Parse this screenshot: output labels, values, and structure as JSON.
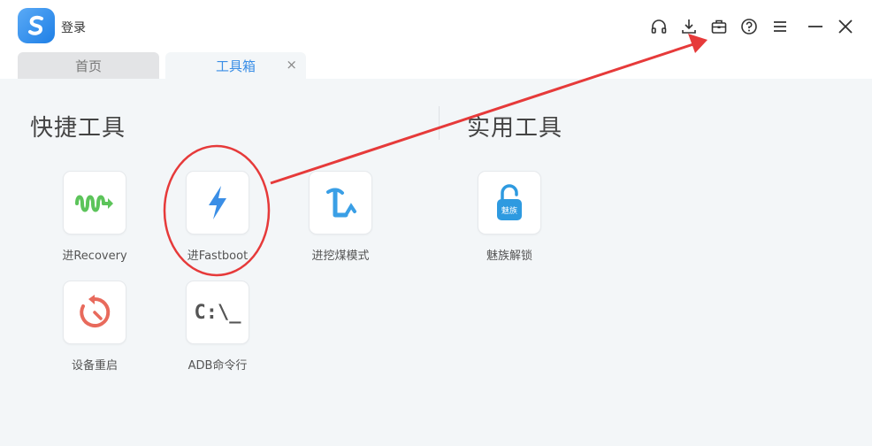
{
  "titlebar": {
    "login_label": "登录",
    "icons": [
      "headphones-icon",
      "download-icon",
      "toolbox-icon",
      "help-icon",
      "menu-icon",
      "minimize-icon",
      "close-icon"
    ]
  },
  "tabs": [
    {
      "label": "首页"
    },
    {
      "label": "工具箱",
      "close": "×"
    }
  ],
  "sections": {
    "quick_title": "快捷工具",
    "util_title": "实用工具"
  },
  "quick_tools": [
    {
      "label": "进Recovery",
      "icon": "recovery-icon"
    },
    {
      "label": "进Fastboot",
      "icon": "lightning-icon"
    },
    {
      "label": "进挖煤模式",
      "icon": "pickaxe-icon"
    },
    {
      "label": "设备重启",
      "icon": "restart-icon"
    },
    {
      "label": "ADB命令行",
      "icon": "terminal-icon",
      "glyph": "C:\\_"
    }
  ],
  "util_tools": [
    {
      "label": "魅族解锁",
      "icon": "unlock-icon",
      "badge": "魅族"
    }
  ],
  "colors": {
    "accent": "#3a8ee6",
    "annotation": "#e63a3a",
    "recovery_green": "#5cc45a",
    "restart_red": "#e86a5c"
  }
}
